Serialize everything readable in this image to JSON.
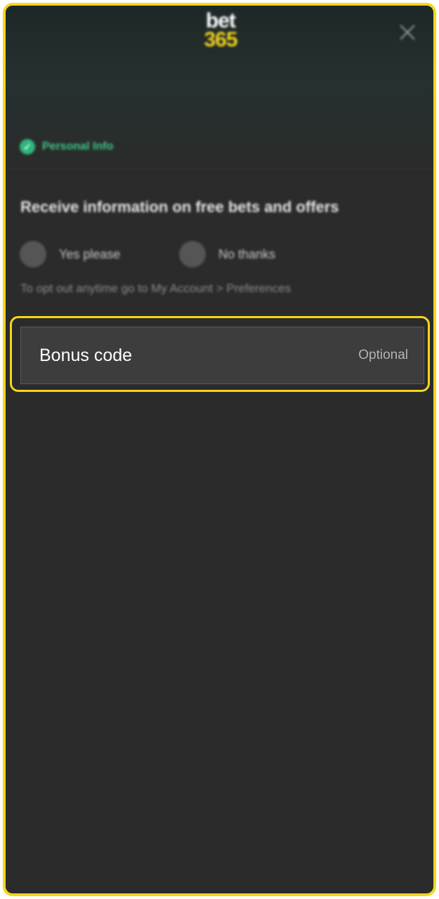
{
  "brand": {
    "logo_top": "bet",
    "logo_bottom": "365",
    "accent_color": "#f5d61b",
    "success_color": "#2fb67c"
  },
  "header": {
    "close_icon": "close-icon",
    "step_icon": "check-circle-icon",
    "step_label": "Personal Info"
  },
  "marketing": {
    "title": "Receive information on free bets and offers",
    "options": [
      {
        "label": "Yes please",
        "selected": false
      },
      {
        "label": "No thanks",
        "selected": false
      }
    ],
    "hint": "To opt out anytime go to My Account > Preferences"
  },
  "bonus": {
    "label": "Bonus code",
    "optional_text": "Optional"
  }
}
